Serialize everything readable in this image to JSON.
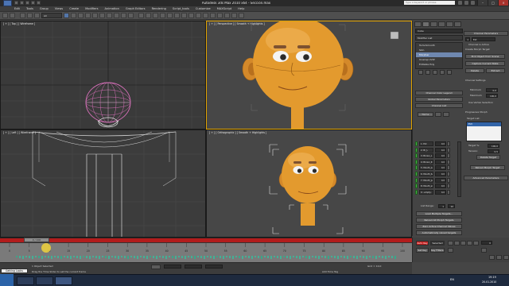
{
  "window": {
    "title": "Autodesk 3ds Max 2010 x64 - Sección.max",
    "search_placeholder": "Type a keyword or phrase",
    "controls": [
      "–",
      "□",
      "×"
    ]
  },
  "menu": [
    "Edit",
    "Tools",
    "Group",
    "Views",
    "Create",
    "Modifiers",
    "Animation",
    "Graph Editors",
    "Rendering",
    "Script_tools",
    "Customize",
    "MAXScript",
    "Help"
  ],
  "toolbar": {
    "selection_set": "All"
  },
  "viewports": {
    "top": "[ + ] [ Top ] [ Wireframe ]",
    "perspective": "[ + ] [ Perspective ] [ Smooth + Highlights ]",
    "left": "[ + ] [ Left ] [ Wireframe ]",
    "ortho": "[ + ] [ Orthographic ] [ Smooth + Highlights ]"
  },
  "command_panel": {
    "object_name": "Cube",
    "modifier_list": "Modifier List",
    "stack": [
      {
        "label": "TurboSmooth",
        "selected": false
      },
      {
        "label": "Skin",
        "selected": false
      },
      {
        "label": "Morpher",
        "selected": true
      },
      {
        "label": "Unwrap UVW",
        "selected": false
      },
      {
        "label": "Editable Poly",
        "selected": false
      }
    ],
    "rollouts_left": [
      "Channel Color Legend",
      "Global Parameters",
      "Channel List"
    ],
    "channel_name_field": "--- Name ---",
    "channels": [
      {
        "name": "1: Ext",
        "value": "0,0"
      },
      {
        "name": "2: Br_L",
        "value": "0,0"
      },
      {
        "name": "3: Brown_L",
        "value": "0,0"
      },
      {
        "name": "4: Brown_R",
        "value": "0,0"
      },
      {
        "name": "5: Mouth_wid",
        "value": "0,0"
      },
      {
        "name": "6: Mouth_Sad",
        "value": "0,0"
      },
      {
        "name": "7: Mouth_pur",
        "value": "0,0"
      },
      {
        "name": "8: Mouth_smi",
        "value": "0,0"
      },
      {
        "name": "9: -empty-",
        "value": "0,0"
      }
    ],
    "list_range_label": "List Range:",
    "list_range": [
      "1",
      "10"
    ],
    "buttons_left": [
      "Load Multiple Targets...",
      "Reload All Morph Targets",
      "Zero Active Channel Values",
      "Automatically reload targets"
    ],
    "right": {
      "channel_params_header": "Channel Parameters",
      "channel_number": "1",
      "channel_name": "Ext",
      "channel_active": "Channel is Active",
      "pick_object": "Pick Object from Scene",
      "capture_state": "Capture Current State",
      "delete": "Delete",
      "extract": "Extract",
      "channel_settings": "Channel Settings",
      "minimum_label": "Minimum",
      "minimum": "0,0",
      "maximum_label": "Maximum",
      "maximum": "100,0",
      "use_vertex_selection": "Use Vertex Selection",
      "progressive_morph": "Progressive Morph",
      "target_list_label": "Target List:",
      "target_list": [
        "Ext"
      ],
      "target_pct_label": "Target %:",
      "target_pct": "100,0",
      "tension_label": "Tension:",
      "tension": "0,5",
      "delete_target": "Delete Target",
      "reload_target": "Reload Morph Target",
      "advanced_parameters": "Advanced Parameters"
    }
  },
  "timeline": {
    "current_frame": "0 / 100",
    "ticks": [
      "0",
      "5",
      "10",
      "15",
      "20",
      "25",
      "30",
      "35",
      "40",
      "45",
      "50",
      "55",
      "60",
      "65",
      "70",
      "75",
      "80",
      "85",
      "90",
      "95",
      "100"
    ]
  },
  "status": {
    "selection": "1 Object Selected",
    "prompt": "Drag the Time Slider to set the current frame",
    "script_label": "Getting Looks",
    "add_time_tag": "Add Time Tag",
    "grid": "Grid = 10,0",
    "auto_key": "Auto Key",
    "set_key": "Set Key",
    "key_filters": "Key Filters...",
    "selected_label": "Selected",
    "frame_field": "0"
  },
  "taskbar": {
    "clock_time": "19:19",
    "clock_date": "20.01.2010",
    "language": "EN"
  },
  "colors": {
    "active_viewport_border": "#e0a200",
    "time_slider": "#b21c1c",
    "auto_key": "#c21c1c",
    "head_skin": "#e39a2e",
    "wireframe": "#d66fb8"
  }
}
